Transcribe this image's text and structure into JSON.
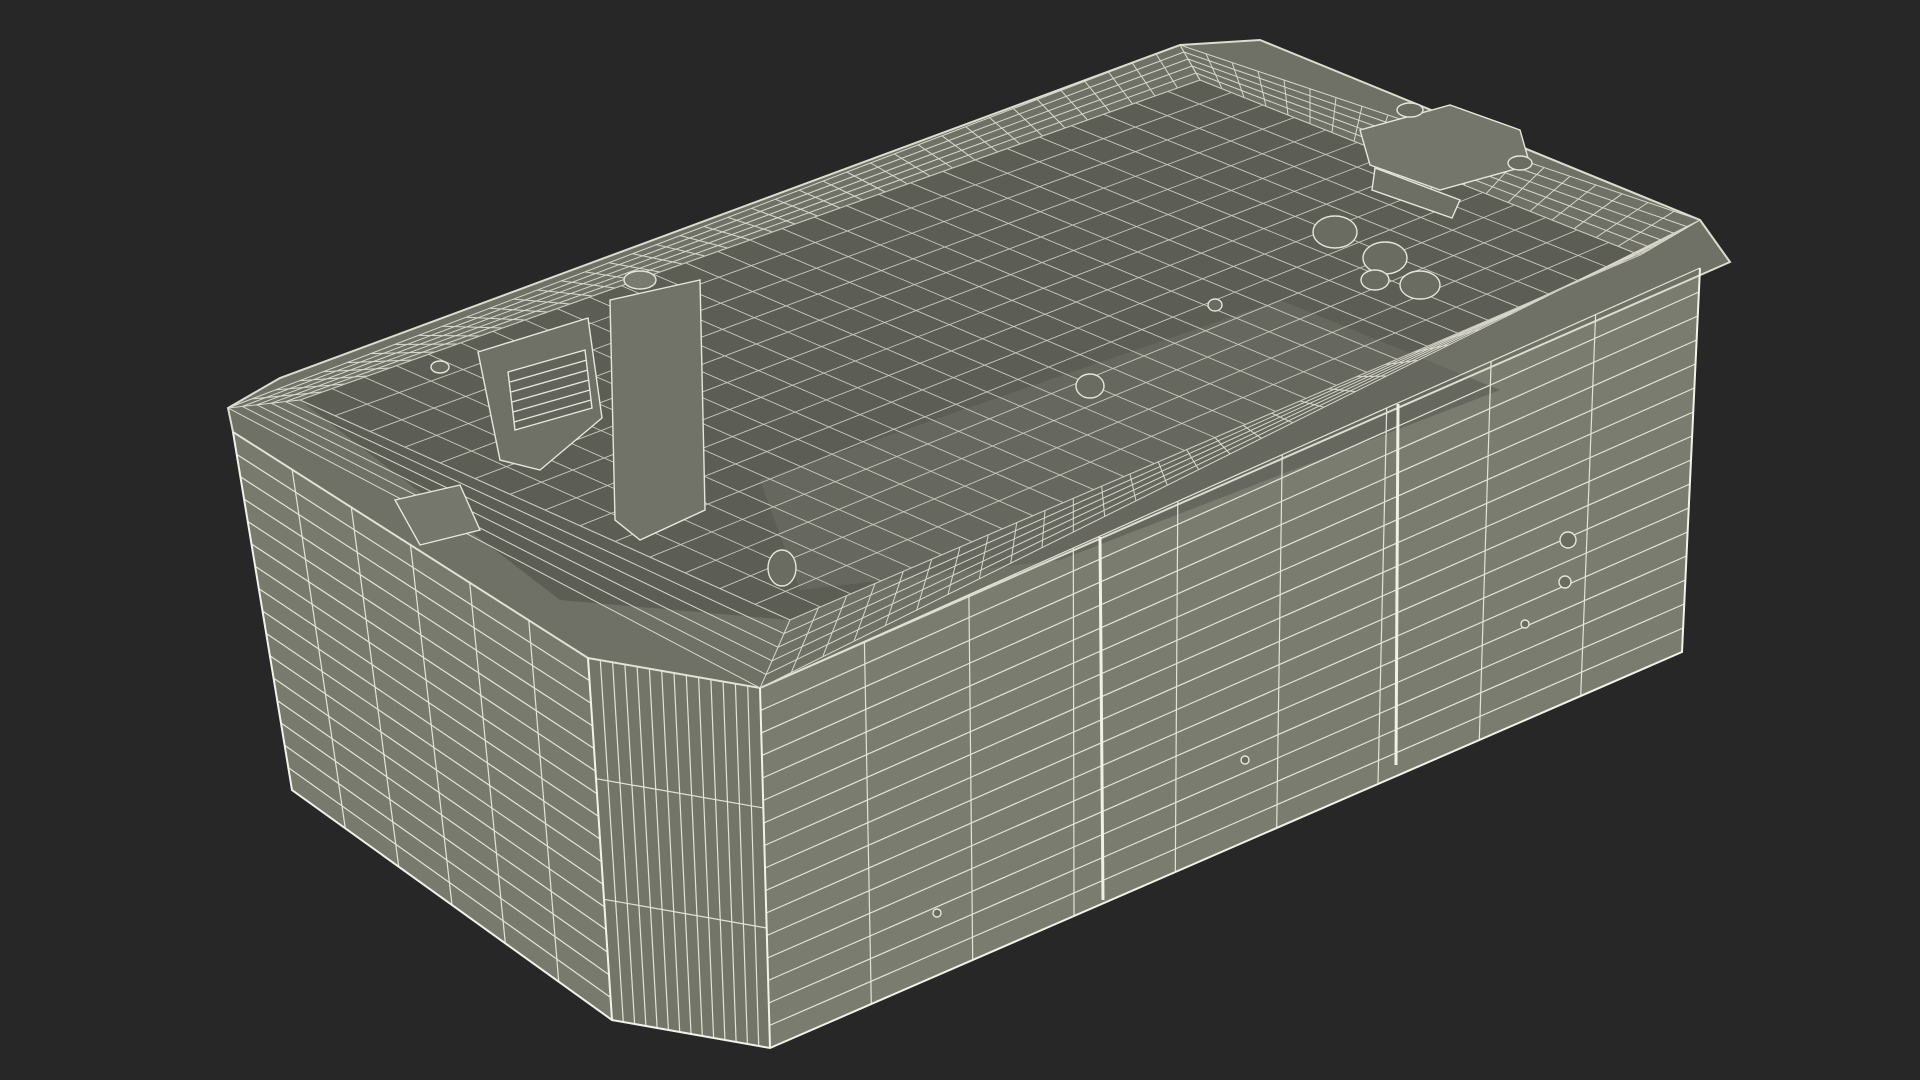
{
  "scene": {
    "subject": "wireframe-swim-spa",
    "render_style": "wireframe-over-clay",
    "colors": {
      "background": "#272727",
      "surface": "#7a7b6f",
      "surface_dark": "#5f6058",
      "surface_light": "#8b8c80",
      "wire": "#e6e6dc",
      "wire_faint": "#c9c9bd"
    }
  }
}
